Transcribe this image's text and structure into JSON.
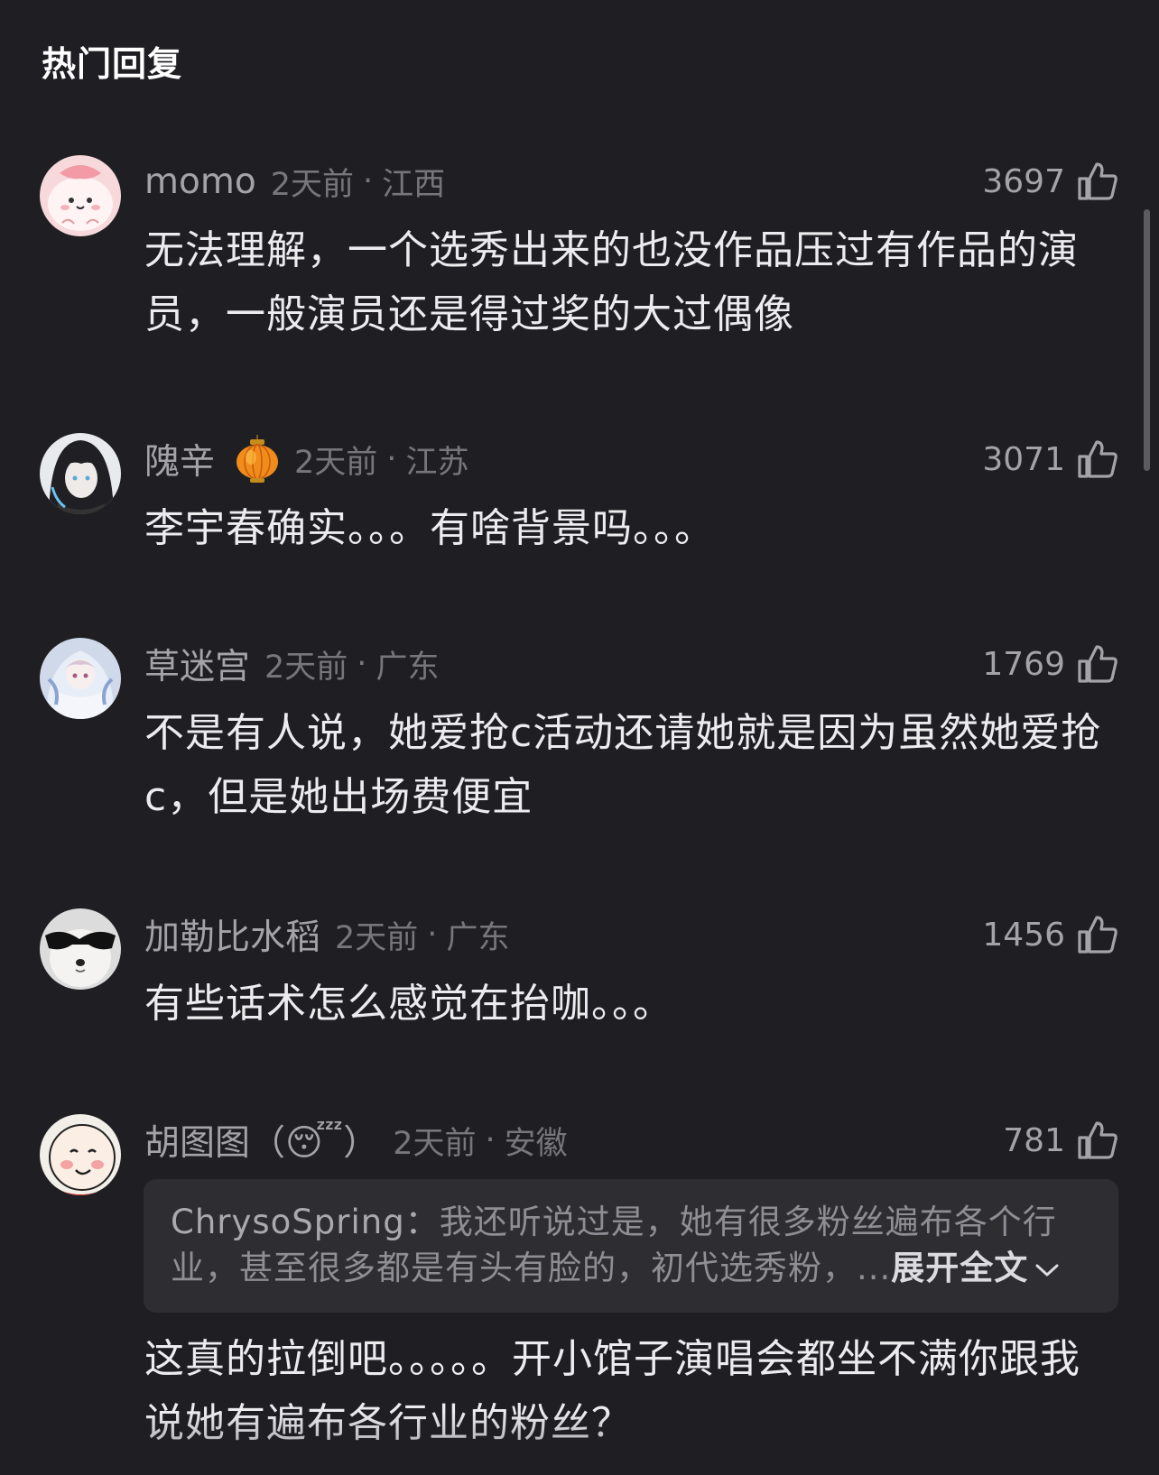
{
  "section_title": "热门回复",
  "comments": [
    {
      "username": "momo",
      "time": "2天前",
      "location": "江西",
      "likes": "3697",
      "text": "无法理解，一个选秀出来的也没作品压过有作品的演员，一般演员还是得过奖的大过偶像",
      "avatar_icon": "pink-blob-avatar"
    },
    {
      "username": "隗辛",
      "badge_icon": "lantern-badge-icon",
      "time": "2天前",
      "location": "江苏",
      "likes": "3071",
      "text": "李宇春确实。。。有啥背景吗。。。",
      "avatar_icon": "anime-boy-avatar"
    },
    {
      "username": "草迷宫",
      "time": "2天前",
      "location": "广东",
      "likes": "1769",
      "text": "不是有人说，她爱抢c活动还请她就是因为虽然她爱抢c，但是她出场费便宜",
      "avatar_icon": "anime-girl-avatar"
    },
    {
      "username": "加勒比水稻",
      "time": "2天前",
      "location": "广东",
      "likes": "1456",
      "text": "有些话术怎么感觉在抬咖。。。",
      "avatar_icon": "dog-sunglasses-avatar"
    },
    {
      "username": "胡图图（",
      "username_emoji": "😴",
      "username_suffix": "）",
      "time": "2天前",
      "location": "安徽",
      "likes": "781",
      "avatar_icon": "cartoon-boy-avatar",
      "quote": {
        "author": "ChrysoSpring：",
        "text": "我还听说过是，她有很多粉丝遍布各个行业，甚至很多都是有头有脸的，初代选秀粉，",
        "ellipsis": "...",
        "expand_label": "展开全文"
      },
      "text": "这真的拉倒吧。。。。。开小馆子演唱会都坐不满你跟我说她有遍布各行业的粉丝？"
    }
  ],
  "meta_separator": "·",
  "colors": {
    "background": "#1f1f23",
    "username": "#a3a3a9",
    "meta": "#76767c",
    "text": "#ececef",
    "quote_bg": "#2d2d32"
  }
}
